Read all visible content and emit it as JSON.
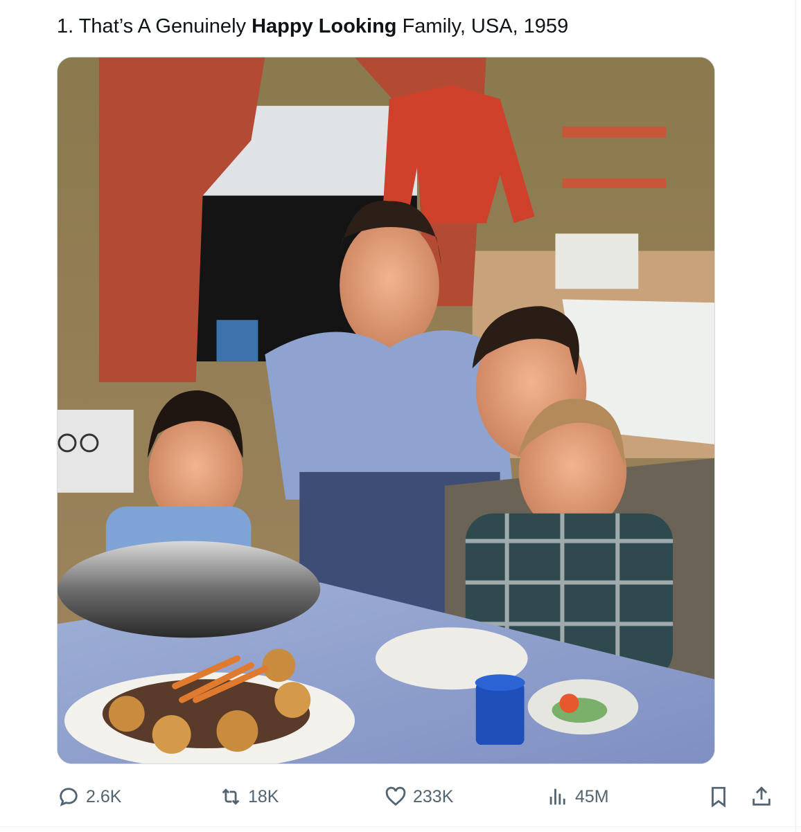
{
  "tweet": {
    "text_prefix": "1. That’s A Genuinely ",
    "text_bold": "Happy Looking",
    "text_suffix": " Family, USA, 1959"
  },
  "actions": {
    "reply": {
      "icon": "reply-icon",
      "count": "2.6K"
    },
    "retweet": {
      "icon": "retweet-icon",
      "count": "18K"
    },
    "like": {
      "icon": "heart-icon",
      "count": "233K"
    },
    "views": {
      "icon": "views-icon",
      "count": "45M"
    },
    "bookmark": {
      "icon": "bookmark-icon"
    },
    "share": {
      "icon": "share-icon"
    }
  },
  "colors": {
    "text": "#0f1419",
    "secondary": "#536471",
    "border": "#cfd9de"
  }
}
